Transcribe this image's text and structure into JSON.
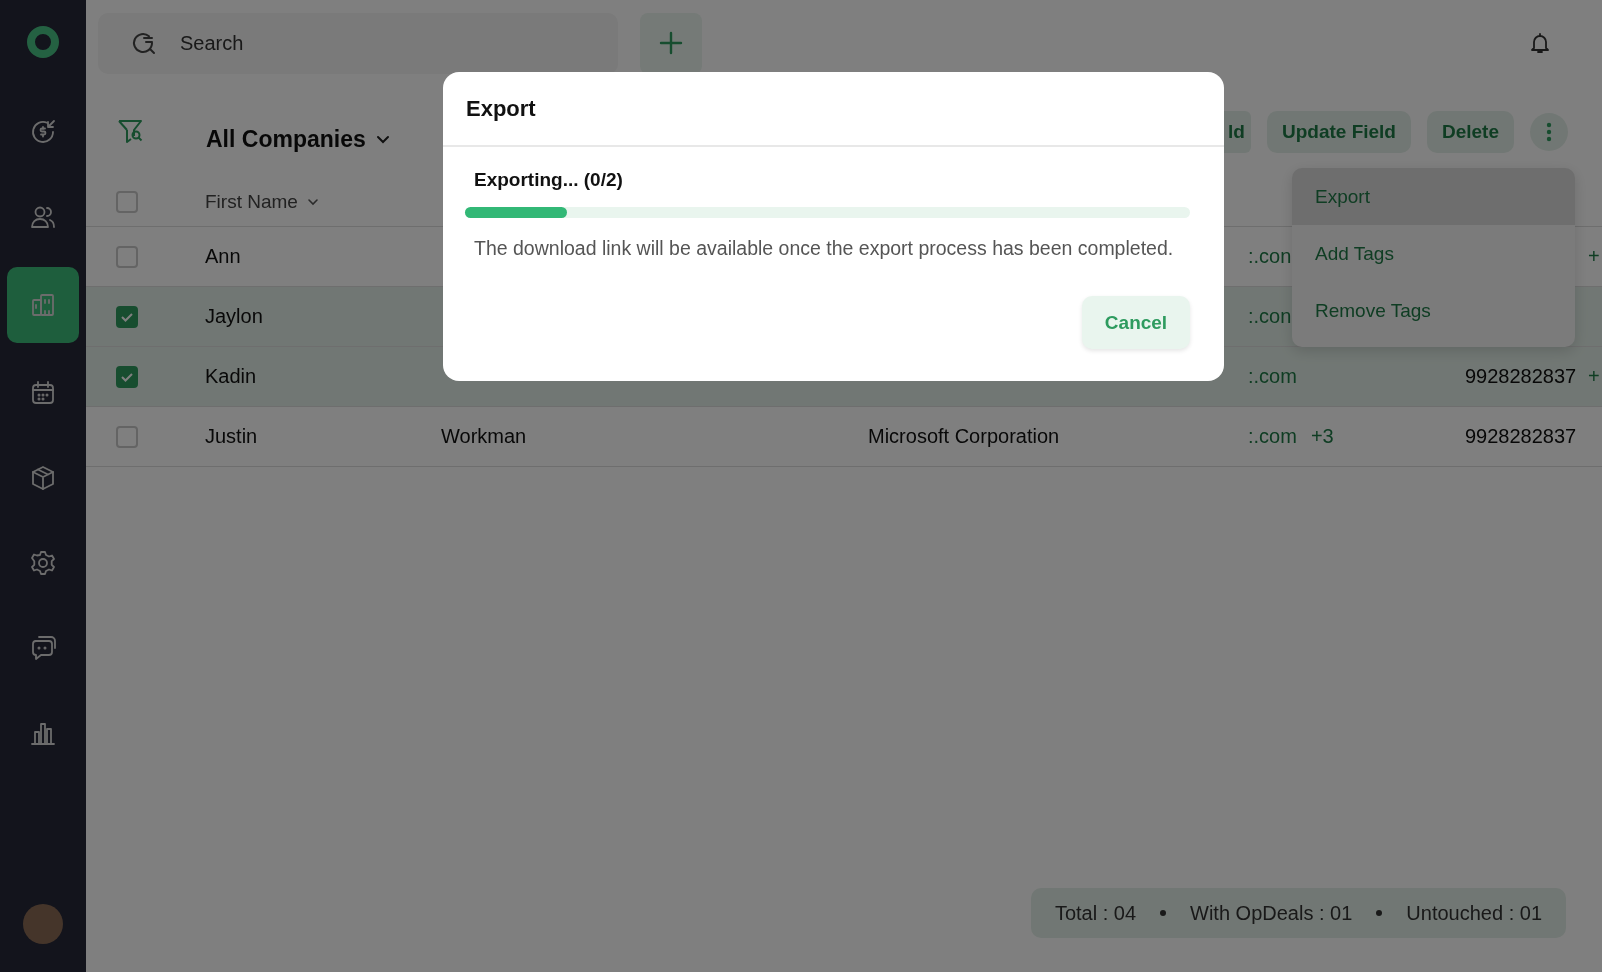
{
  "sidebar": {
    "items": [
      {
        "kind": "deals",
        "selected": false
      },
      {
        "kind": "contacts",
        "selected": false
      },
      {
        "kind": "companies",
        "selected": true
      },
      {
        "kind": "calendar",
        "selected": false
      },
      {
        "kind": "products",
        "selected": false
      },
      {
        "kind": "settings",
        "selected": false
      },
      {
        "kind": "chat",
        "selected": false
      },
      {
        "kind": "reports",
        "selected": false
      }
    ]
  },
  "search": {
    "placeholder": "Search"
  },
  "view_title": "All Companies",
  "toolbar": {
    "buttons": [
      "ld",
      "Update Field",
      "Delete"
    ]
  },
  "menu": {
    "items": [
      {
        "label": "Export",
        "selected": true
      },
      {
        "label": "Add Tags",
        "selected": false
      },
      {
        "label": "Remove Tags",
        "selected": false
      }
    ]
  },
  "table": {
    "header_checkbox": {
      "checked": false
    },
    "columns": [
      {
        "label": "First Name"
      }
    ],
    "rows": [
      {
        "checked": false,
        "first_name": "Ann",
        "email": ":.con",
        "more": "+"
      },
      {
        "checked": true,
        "first_name": "Jaylon",
        "email": ":.con"
      },
      {
        "checked": true,
        "first_name": "Kadin",
        "email": ":.com",
        "phone": "9928282837",
        "more": "+"
      },
      {
        "checked": false,
        "first_name": "Justin",
        "last_name": "Workman",
        "company": "Microsoft Corporation",
        "email": ":.com",
        "email_more": "+3",
        "phone": "9928282837"
      }
    ]
  },
  "status_bar": {
    "items": [
      "Total : 04",
      "With OpDeals : 01",
      "Untouched : 01"
    ]
  },
  "dialog": {
    "title": "Export",
    "status": "Exporting... (0/2)",
    "level": 0.14,
    "message": "The download link will be available once the export process has been completed.",
    "buttons": [
      "Cancel"
    ]
  }
}
